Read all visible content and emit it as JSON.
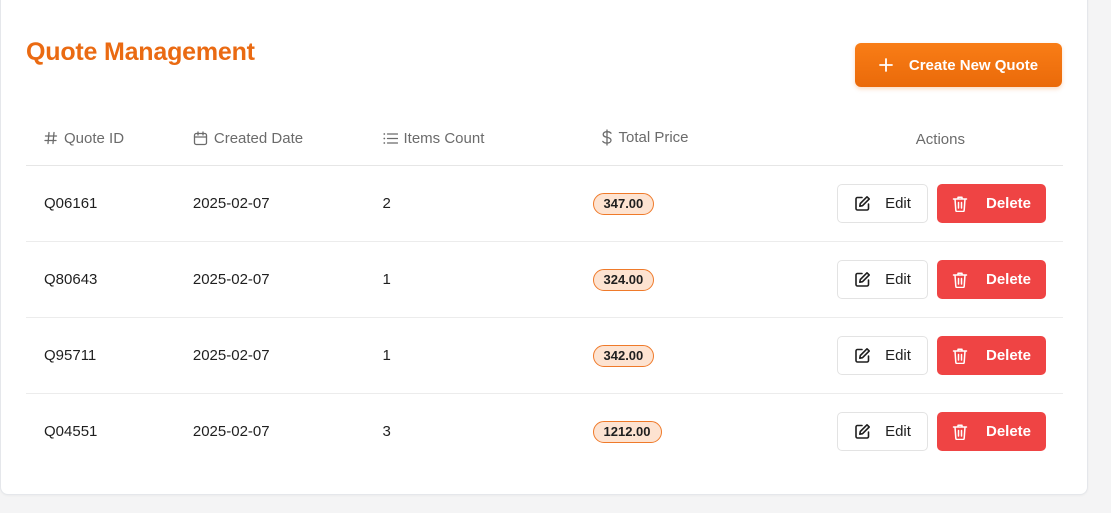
{
  "page": {
    "title": "Quote Management",
    "create_button_label": "Create New Quote"
  },
  "colors": {
    "accent": "#ea6a12",
    "danger": "#ef4444",
    "badge_bg": "#fde3d1",
    "badge_border": "#ef7a2a"
  },
  "table": {
    "columns": [
      {
        "label": "Quote ID",
        "icon": "hash-icon"
      },
      {
        "label": "Created Date",
        "icon": "calendar-icon"
      },
      {
        "label": "Items Count",
        "icon": "list-icon"
      },
      {
        "label": "Total Price",
        "icon": "dollar-icon"
      },
      {
        "label": "Actions",
        "icon": ""
      }
    ],
    "rows": [
      {
        "id": "Q06161",
        "date": "2025-02-07",
        "items": "2",
        "price": "347.00",
        "edit": "Edit",
        "delete": "Delete"
      },
      {
        "id": "Q80643",
        "date": "2025-02-07",
        "items": "1",
        "price": "324.00",
        "edit": "Edit",
        "delete": "Delete"
      },
      {
        "id": "Q95711",
        "date": "2025-02-07",
        "items": "1",
        "price": "342.00",
        "edit": "Edit",
        "delete": "Delete"
      },
      {
        "id": "Q04551",
        "date": "2025-02-07",
        "items": "3",
        "price": "1212.00",
        "edit": "Edit",
        "delete": "Delete"
      }
    ]
  }
}
